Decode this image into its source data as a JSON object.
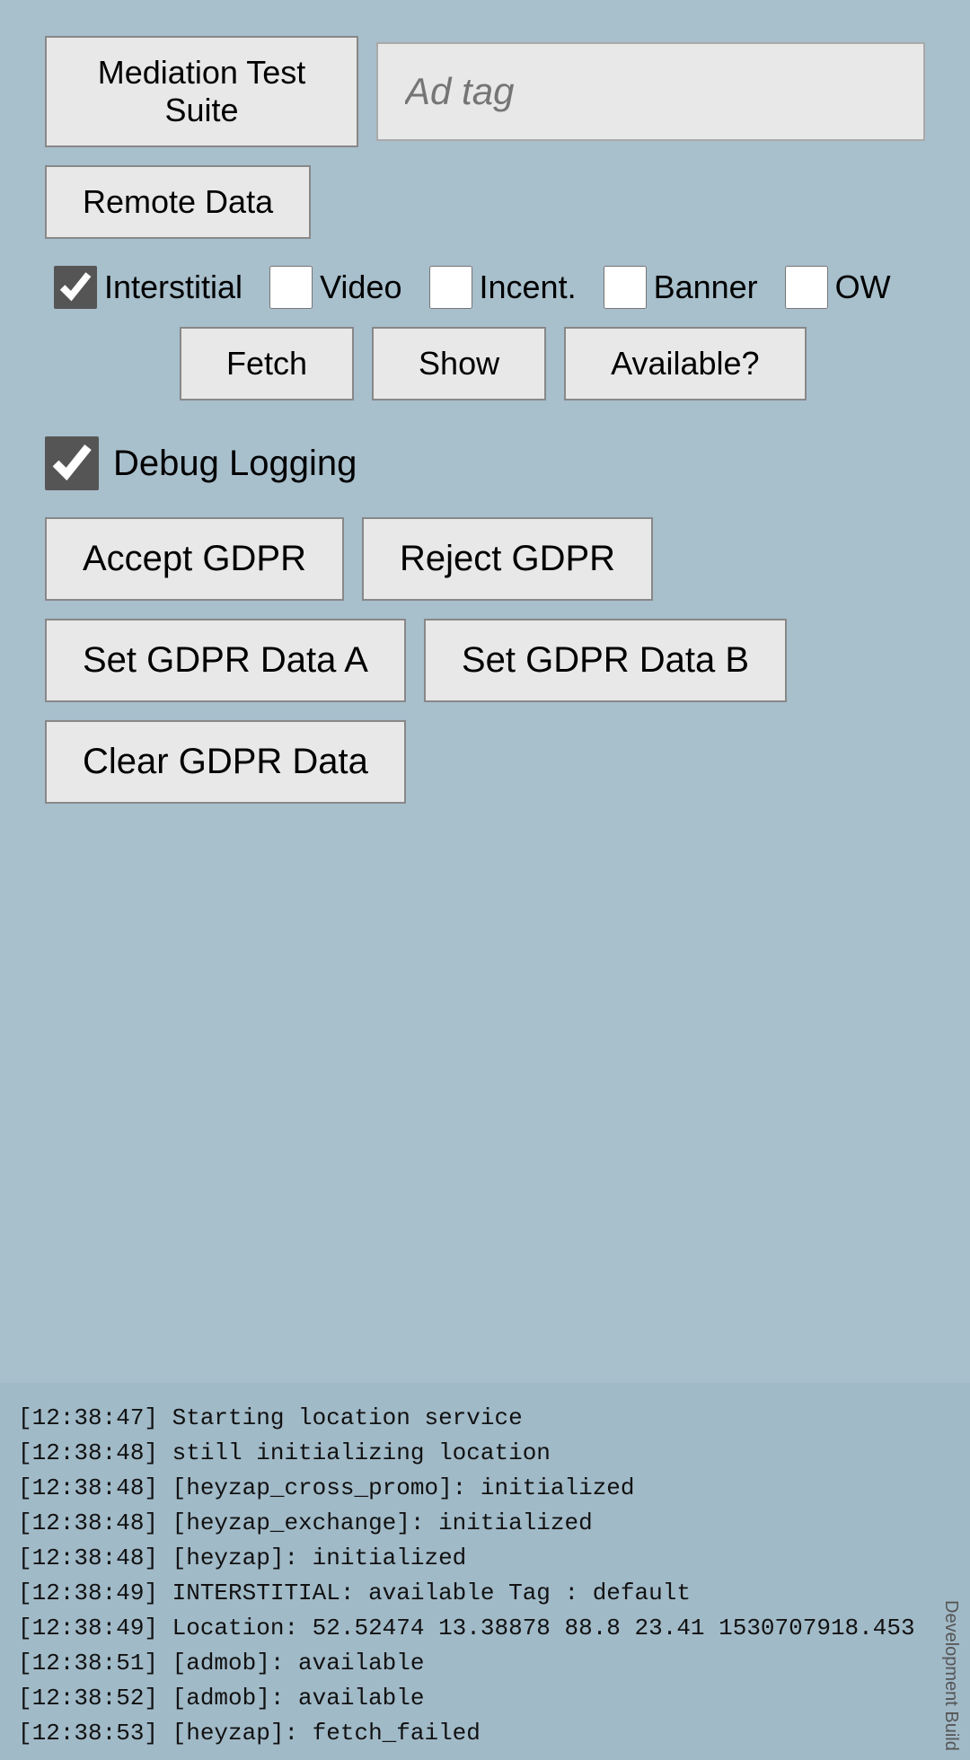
{
  "app": {
    "title": "Mediation Test Suite",
    "ad_tag_placeholder": "Ad tag"
  },
  "buttons": {
    "remote_data": "Remote Data",
    "fetch": "Fetch",
    "show": "Show",
    "available": "Available?",
    "accept_gdpr": "Accept GDPR",
    "reject_gdpr": "Reject GDPR",
    "set_gdpr_a": "Set GDPR Data A",
    "set_gdpr_b": "Set GDPR Data B",
    "clear_gdpr": "Clear GDPR Data"
  },
  "checkboxes": {
    "interstitial_label": "Interstitial",
    "interstitial_checked": true,
    "video_label": "Video",
    "video_checked": false,
    "incent_label": "Incent.",
    "incent_checked": false,
    "banner_label": "Banner",
    "banner_checked": false,
    "ow_label": "OW",
    "ow_checked": false,
    "debug_label": "Debug Logging",
    "debug_checked": true
  },
  "log": {
    "lines": [
      "[12:38:47] Starting location service",
      "[12:38:48] still initializing location",
      "[12:38:48] [heyzap_cross_promo]: initialized",
      "[12:38:48] [heyzap_exchange]: initialized",
      "[12:38:48] [heyzap]: initialized",
      "[12:38:49] INTERSTITIAL: available Tag : default",
      "[12:38:49] Location: 52.52474 13.38878 88.8 23.41 1530707918.453",
      "[12:38:51] [admob]: available",
      "[12:38:52] [admob]: available",
      "[12:38:53] [heyzap]: fetch_failed"
    ]
  },
  "dev_build": "Development Build"
}
